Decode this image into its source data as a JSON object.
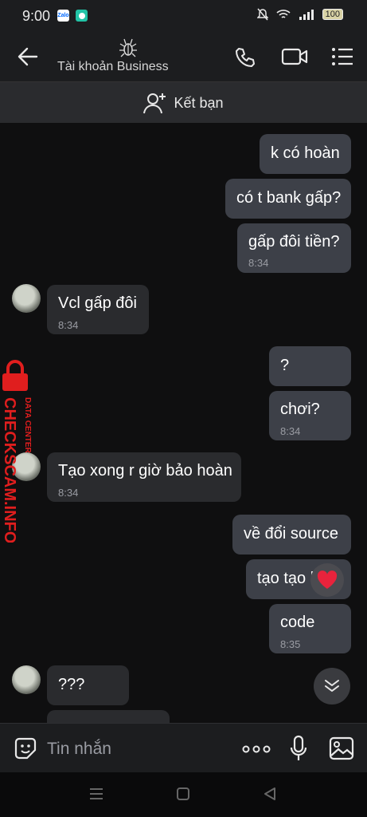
{
  "status_bar": {
    "time": "9:00",
    "app_icons": [
      "Zalo",
      "messenger-bubble-icon"
    ],
    "battery": "100"
  },
  "header": {
    "title": "Tài khoản Business",
    "icons": [
      "back-arrow-icon",
      "business-logo-icon",
      "phone-icon",
      "video-call-icon",
      "menu-list-icon"
    ]
  },
  "friend_bar": {
    "label": "Kết bạn",
    "icon": "add-friend-icon"
  },
  "messages": [
    {
      "side": "out",
      "text": "k có hoàn",
      "time": ""
    },
    {
      "side": "out",
      "text": "có t bank gấp?",
      "time": ""
    },
    {
      "side": "out",
      "text": "gấp đôi tiền?",
      "time": "8:34"
    },
    {
      "side": "in",
      "text": "Vcl gấp đôi",
      "time": "8:34"
    },
    {
      "side": "out",
      "text": "?",
      "time": ""
    },
    {
      "side": "out",
      "text": "chơi?",
      "time": "8:34"
    },
    {
      "side": "in",
      "text": "Tạo xong r giờ bảo hoàn",
      "time": "8:34"
    },
    {
      "side": "out",
      "text": "về đổi source",
      "time": ""
    },
    {
      "side": "out",
      "text": "tạo tạo lạ",
      "time": ""
    },
    {
      "side": "out",
      "text": "code",
      "time": "8:35"
    },
    {
      "side": "in",
      "text": "???",
      "time": ""
    }
  ],
  "watermark": {
    "line1": "DATA CENTER",
    "line2": "CHECKSCAM.INFO",
    "color": "#e01e1e"
  },
  "input_bar": {
    "placeholder": "Tin nhắn",
    "icons": [
      "sticker-icon",
      "more-icon",
      "microphone-icon",
      "image-icon"
    ]
  },
  "nav_bar": {
    "icons": [
      "recent-apps-icon",
      "home-icon",
      "back-icon"
    ]
  },
  "colors": {
    "background": "#0f0f10",
    "bubble_out": "#3d4048",
    "bubble_in": "#2a2b2e",
    "time_text": "#9a9ca3"
  }
}
